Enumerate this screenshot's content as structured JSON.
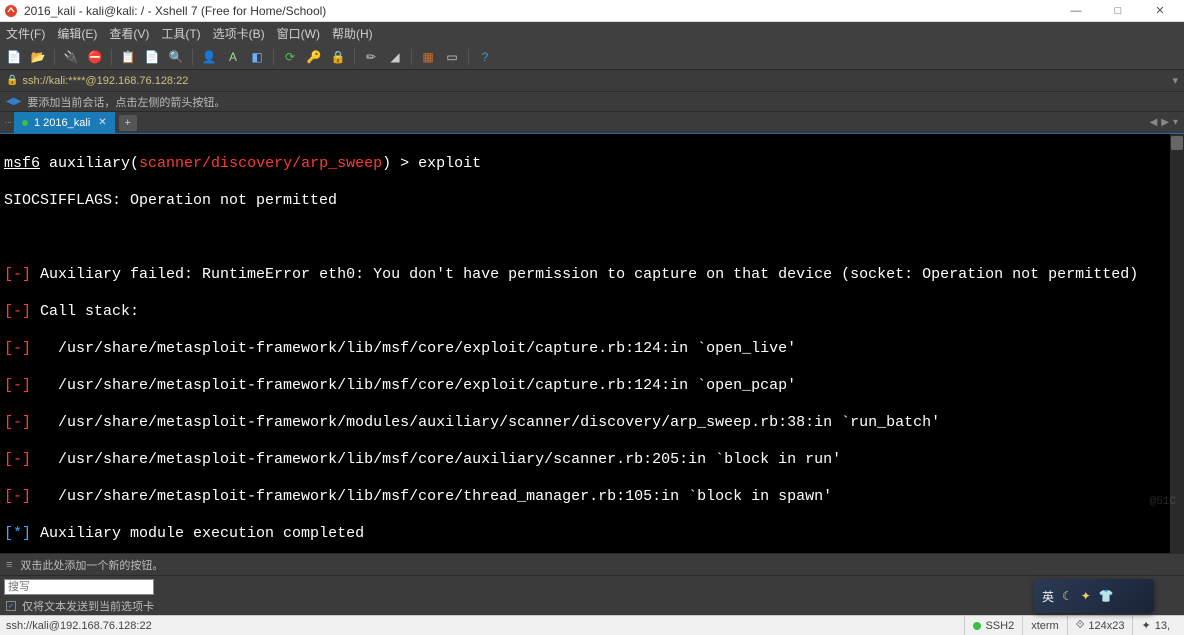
{
  "window": {
    "title": "2016_kali - kali@kali: / - Xshell 7 (Free for Home/School)"
  },
  "menu": {
    "file": "文件(F)",
    "edit": "编辑(E)",
    "view": "查看(V)",
    "tools": "工具(T)",
    "tabs": "选项卡(B)",
    "window": "窗口(W)",
    "help": "帮助(H)"
  },
  "address": {
    "text": "ssh://kali:****@192.168.76.128:22"
  },
  "hint": {
    "text": "要添加当前会话，点击左侧的箭头按钮。"
  },
  "tab": {
    "label": "1 2016_kali"
  },
  "terminal": {
    "prompt_prefix": "msf6",
    "prompt_aux": " auxiliary(",
    "prompt_module": "scanner/discovery/arp_sweep",
    "prompt_close": ") > ",
    "cmd1": "exploit",
    "line_siocs": "SIOCSIFFLAGS: Operation not permitted",
    "err_tag": "[-]",
    "info_tag": "[*]",
    "fail_line": " Auxiliary failed: RuntimeError eth0: You don't have permission to capture on that device (socket: Operation not permitted)",
    "callstack": " Call stack:",
    "st1": "   /usr/share/metasploit-framework/lib/msf/core/exploit/capture.rb:124:in `open_live'",
    "st2": "   /usr/share/metasploit-framework/lib/msf/core/exploit/capture.rb:124:in `open_pcap'",
    "st3": "   /usr/share/metasploit-framework/modules/auxiliary/scanner/discovery/arp_sweep.rb:38:in `run_batch'",
    "st4": "   /usr/share/metasploit-framework/lib/msf/core/auxiliary/scanner.rb:205:in `block in run'",
    "st5": "   /usr/share/metasploit-framework/lib/msf/core/thread_manager.rb:105:in `block in spawn'",
    "done": " Auxiliary module execution completed"
  },
  "bottom": {
    "hint": "双击此处添加一个新的按钮。",
    "input_placeholder": "搜写",
    "send_info": "仅将文本发送到当前选项卡"
  },
  "status": {
    "left": "ssh://kali@192.168.76.128:22",
    "ssh": "SSH2",
    "term": "xterm",
    "size": "124x23",
    "pos": "13,",
    "watermark": "@51C"
  },
  "lang": {
    "label": "英"
  }
}
